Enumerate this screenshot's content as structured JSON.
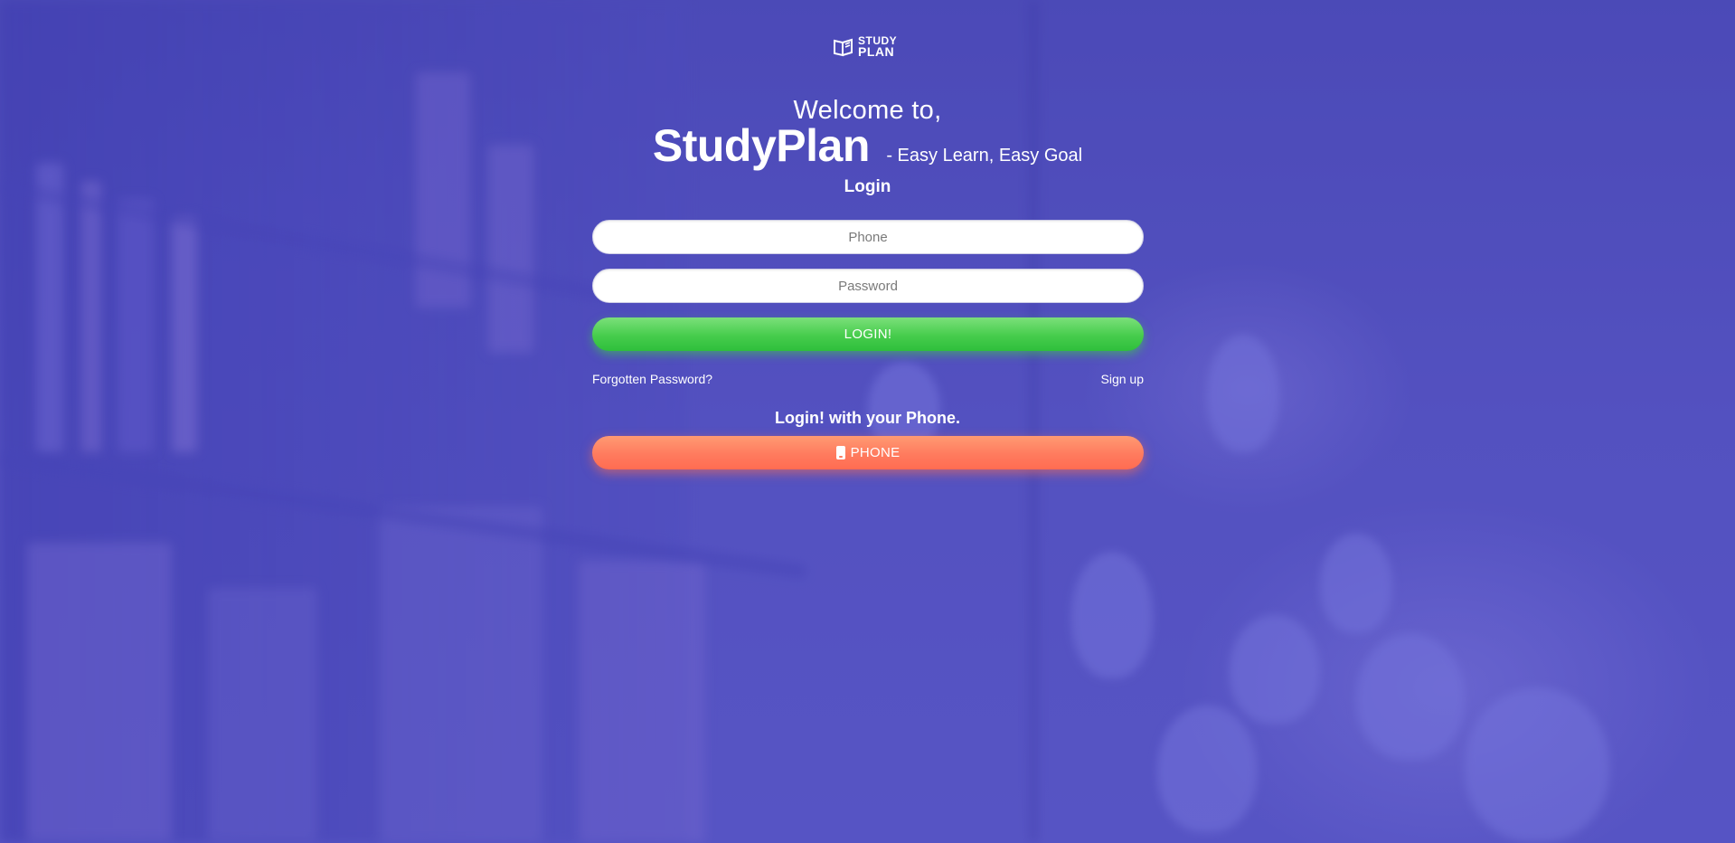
{
  "logo": {
    "line1": "STUDY",
    "line2": "PLAN"
  },
  "hero": {
    "welcome": "Welcome to,",
    "brand": "StudyPlan",
    "tagline": "- Easy Learn, Easy Goal"
  },
  "login_form": {
    "title": "Login",
    "phone_placeholder": "Phone",
    "password_placeholder": "Password",
    "submit_label": "LOGIN!",
    "forgot_label": "Forgotten Password?",
    "signup_label": "Sign up"
  },
  "phone_login": {
    "title": "Login! with your Phone.",
    "button_label": "PHONE",
    "icon": "mobile-phone-icon"
  },
  "colors": {
    "background": "#5150b8",
    "login_button": "#46cc4c",
    "phone_button": "#ff7b5e"
  }
}
